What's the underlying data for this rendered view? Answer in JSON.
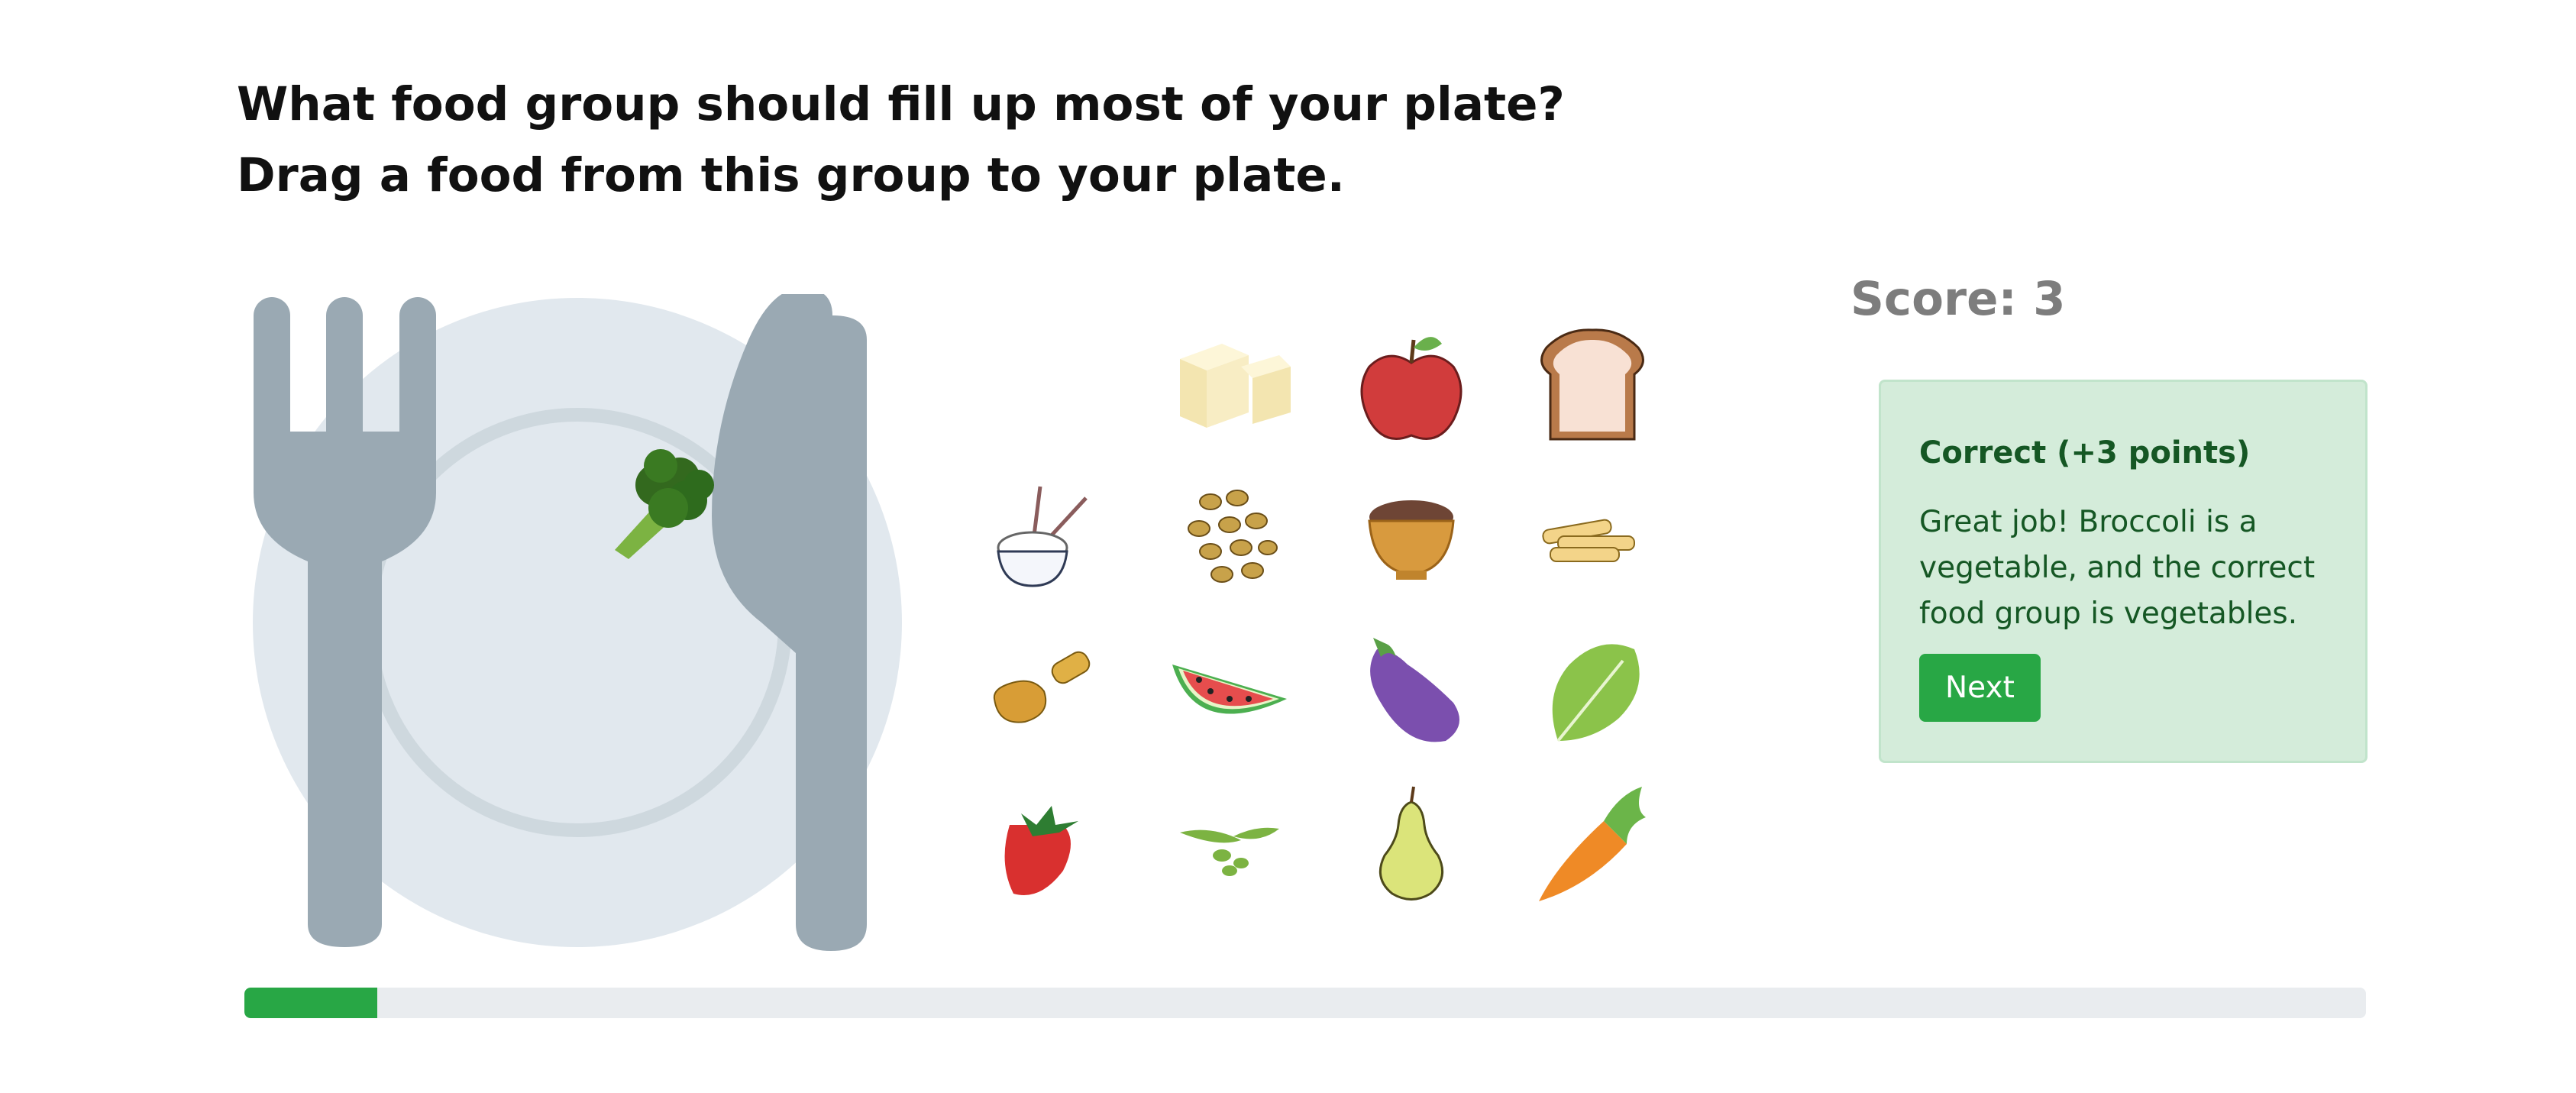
{
  "question": {
    "line1": "What food group should fill up most of your plate?",
    "line2": "Drag a food from this group to your plate."
  },
  "score": {
    "label": "Score: 3"
  },
  "feedback": {
    "title": "Correct (+3 points)",
    "body": "Great job! Broccoli is a vegetable, and the correct food group is vegetables.",
    "next_label": "Next"
  },
  "progress": {
    "fraction": 0.0625,
    "fill_color": "#28a745",
    "track_color": "#e9ecef"
  },
  "plate": {
    "placed_food_icon": "broccoli-icon"
  },
  "foods": [
    {
      "icon": "tofu-icon"
    },
    {
      "icon": "apple-icon"
    },
    {
      "icon": "bread-icon"
    },
    {
      "icon": "rice-bowl-icon"
    },
    {
      "icon": "beans-icon"
    },
    {
      "icon": "grain-bowl-icon"
    },
    {
      "icon": "pasta-icon"
    },
    {
      "icon": "grain-scoop-icon"
    },
    {
      "icon": "watermelon-icon"
    },
    {
      "icon": "eggplant-icon"
    },
    {
      "icon": "spinach-icon"
    },
    {
      "icon": "strawberry-icon"
    },
    {
      "icon": "edamame-icon"
    },
    {
      "icon": "pear-icon"
    },
    {
      "icon": "carrot-icon"
    }
  ],
  "colors": {
    "accent": "#28a745",
    "feedback_bg": "#d4ecda",
    "feedback_text": "#155724",
    "score_text": "#7d7d7d",
    "utensil": "#9aa9b3",
    "plate": "#e1e8ee"
  }
}
